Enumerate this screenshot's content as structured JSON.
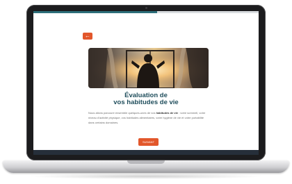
{
  "screen": {
    "progress": 0.55,
    "back_label": "←",
    "hero_icon": "window-silhouette-image",
    "title_line1": "Évaluation de",
    "title_line2": "vos habitudes de vie",
    "intro_before": "Nous allons parcourir ensemble quelques-unes de vos ",
    "intro_bold": "habitudes de vie",
    "intro_after": " : votre sommeil, votre niveau d'activité physique, vos habitudes alimentaires, votre hygiène de vie et votre portabilité dans certains domaines.",
    "next_label": "SUIVANT"
  },
  "colors": {
    "accent": "#e2572b",
    "title": "#214f5d",
    "progress": "#2d6f7a",
    "footer": "#262f3a"
  }
}
